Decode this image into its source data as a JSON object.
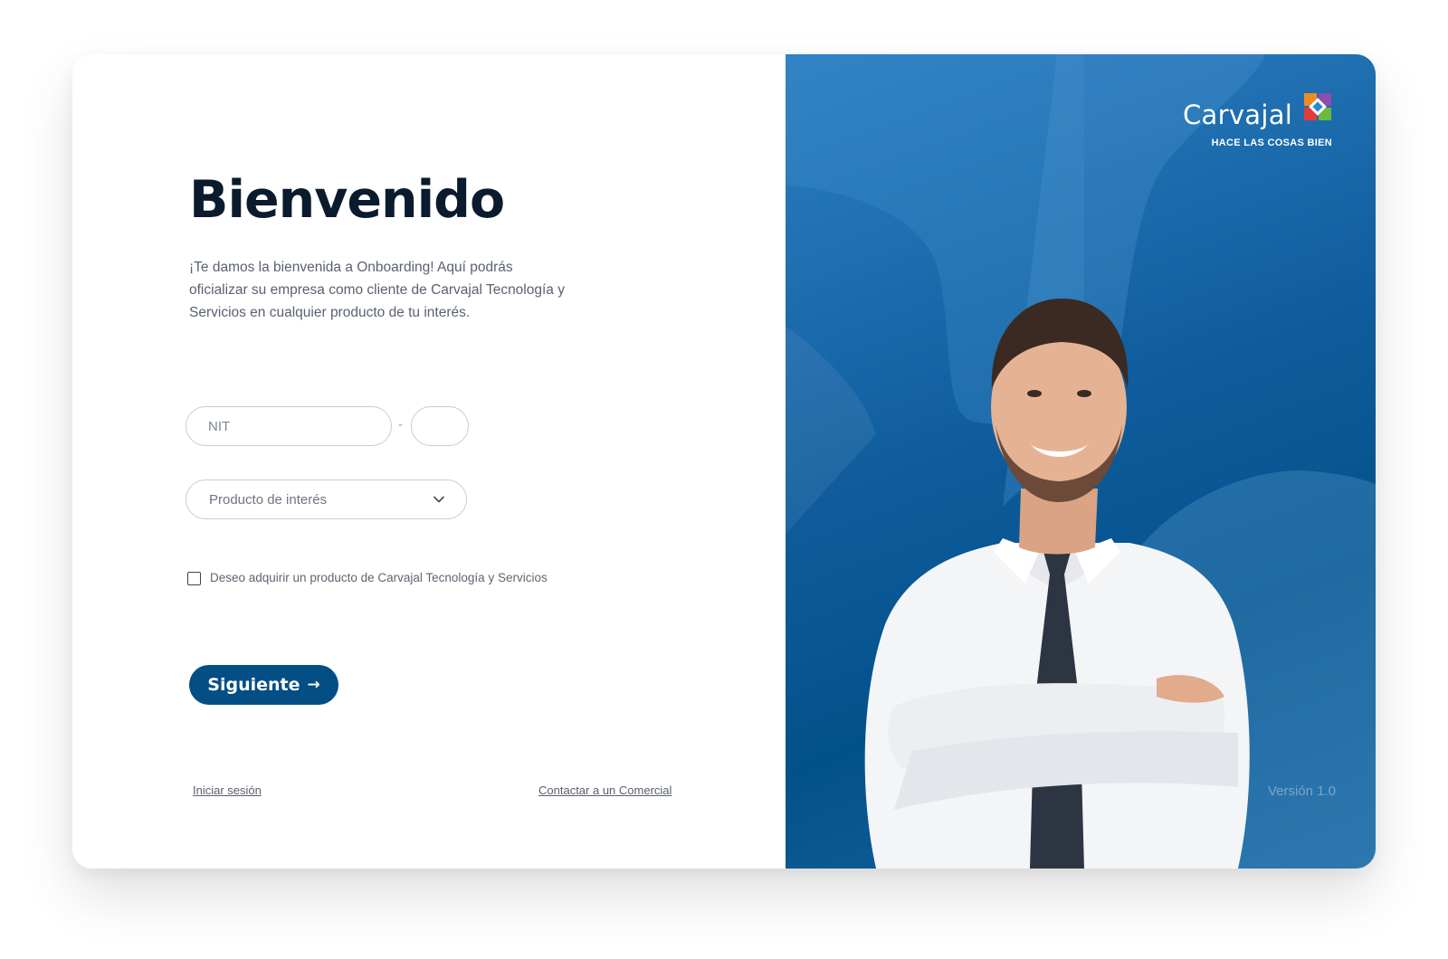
{
  "welcome": {
    "title": "Bienvenido",
    "intro_line1": "¡Te damos la bienvenida a Onboarding! Aquí podrás",
    "intro_line2": "oficializar su empresa como cliente de Carvajal Tecnología y",
    "intro_line3": "Servicios en cualquier producto de tu interés."
  },
  "form": {
    "nit_placeholder": "NIT",
    "nit_value": "",
    "separator": "-",
    "dv_value": "",
    "product_select": {
      "selected": "Producto de interés",
      "icon": "chevron-down-icon"
    },
    "consent": {
      "checked": false,
      "label": "Deseo adquirir un producto de Carvajal Tecnología y Servicios"
    },
    "next_button": {
      "label": "Siguiente",
      "icon": "arrow-right-icon"
    }
  },
  "footer_links": {
    "login": "Iniciar sesión",
    "contact": "Contactar a un Comercial"
  },
  "brand": {
    "name": "Carvajal",
    "tagline": "HACE LAS COSAS BIEN",
    "primary_color": "#034e85",
    "panel_color": "#1565a8"
  },
  "version": "Versión 1.0"
}
